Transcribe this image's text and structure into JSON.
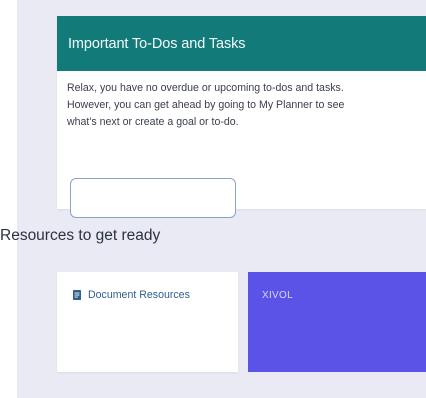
{
  "todos": {
    "title": "Important To-Dos and Tasks",
    "message_lines": [
      "Relax, you have no overdue or upcoming to-dos and tasks.",
      "However, you can get ahead by going to My Planner to see",
      "what's next or create a goal or to-do."
    ],
    "input": {
      "value": "",
      "placeholder": ""
    }
  },
  "resources": {
    "heading": "Resources to get ready",
    "cards": [
      {
        "label": "Document Resources",
        "icon": "document-icon"
      },
      {
        "label": "XIVOL"
      }
    ]
  },
  "colors": {
    "page_background": "#e9eaf3",
    "header_teal": "#137a7a",
    "accent_purple": "#5b52e8",
    "link_blue": "#2f5f8a",
    "input_border": "#8aa4c4"
  }
}
